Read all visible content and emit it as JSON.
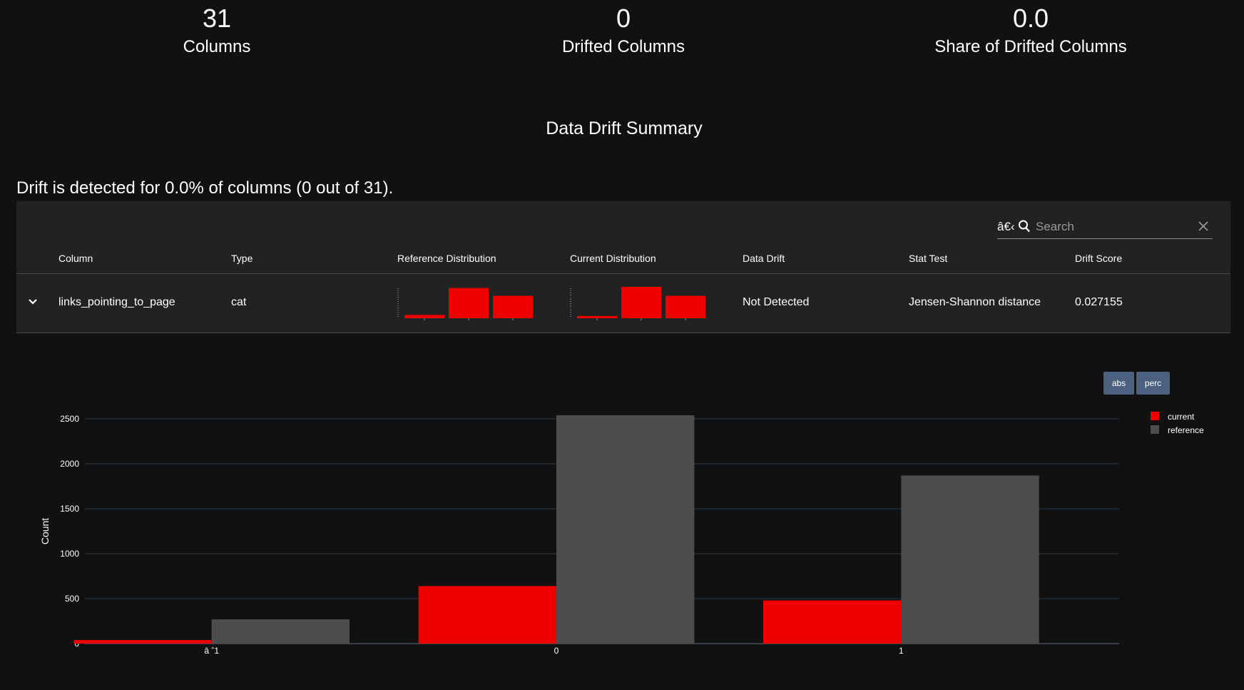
{
  "metrics": [
    {
      "value": "31",
      "label": "Columns"
    },
    {
      "value": "0",
      "label": "Drifted Columns"
    },
    {
      "value": "0.0",
      "label": "Share of Drifted Columns"
    }
  ],
  "section_title": "Data Drift Summary",
  "summary_text": "Drift is detected for 0.0% of columns (0 out of 31).",
  "search": {
    "prefix": "â€‹",
    "placeholder": "Search"
  },
  "table": {
    "headers": {
      "column": "Column",
      "type": "Type",
      "ref_dist": "Reference Distribution",
      "cur_dist": "Current Distribution",
      "data_drift": "Data Drift",
      "stat_test": "Stat Test",
      "drift_score": "Drift Score"
    },
    "rows": [
      {
        "column": "links_pointing_to_page",
        "type": "cat",
        "data_drift": "Not Detected",
        "stat_test": "Jensen-Shannon distance",
        "drift_score": "0.027155",
        "ref_spark": [
          0.06,
          0.54,
          0.4
        ],
        "cur_spark": [
          0.04,
          0.56,
          0.4
        ]
      }
    ]
  },
  "detail": {
    "buttons": {
      "abs": "abs",
      "perc": "perc"
    }
  },
  "colors": {
    "current": "#ee0000",
    "reference": "#4d4d4d",
    "button": "#4c6180"
  },
  "chart_data": {
    "type": "bar",
    "categories": [
      "â ˆ1",
      "0",
      "1"
    ],
    "series": [
      {
        "name": "current",
        "values": [
          40,
          640,
          480
        ]
      },
      {
        "name": "reference",
        "values": [
          270,
          2540,
          1870
        ]
      }
    ],
    "ylabel": "Count",
    "xlabel": "",
    "ylim": [
      0,
      2500
    ],
    "yticks": [
      0,
      500,
      1000,
      1500,
      2000,
      2500
    ],
    "legend": "top-right",
    "grid": true
  }
}
